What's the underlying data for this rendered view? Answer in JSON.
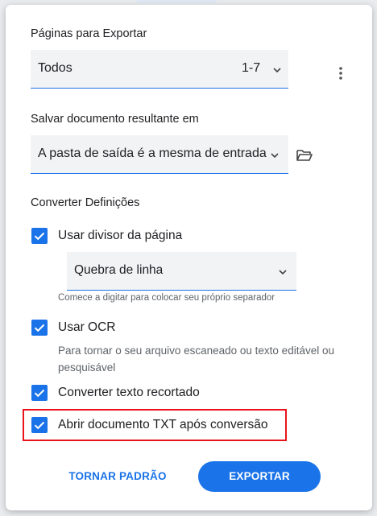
{
  "pages": {
    "section_title": "Páginas para Exportar",
    "select_value": "Todos",
    "range": "1-7"
  },
  "output": {
    "section_title": "Salvar documento resultante em",
    "select_value": "A pasta de saída é a mesma de entrada"
  },
  "settings": {
    "section_title": "Converter Definições",
    "page_divider": {
      "label": "Usar divisor da página",
      "checked": true,
      "dropdown_value": "Quebra de linha",
      "hint": "Comece a digitar para colocar seu próprio separador"
    },
    "ocr": {
      "label": "Usar OCR",
      "checked": true,
      "hint": "Para tornar o seu arquivo escaneado ou texto editável ou pesquisável"
    },
    "cropped_text": {
      "label": "Converter texto recortado",
      "checked": true
    },
    "open_txt": {
      "label": "Abrir documento TXT após conversão",
      "checked": true
    }
  },
  "actions": {
    "default_label": "TORNAR PADRÃO",
    "export_label": "EXPORTAR"
  },
  "colors": {
    "accent": "#1a73e8",
    "highlight": "#e8131b",
    "field_bg": "#f1f3f4"
  },
  "icons": {
    "kebab": "more-vert-icon",
    "folder": "folder-open-icon",
    "chevron": "chevron-down-icon",
    "check": "check-icon"
  }
}
